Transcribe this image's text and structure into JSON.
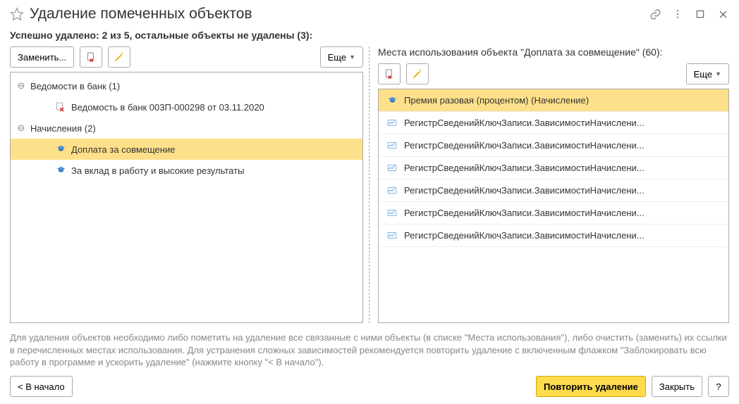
{
  "title": "Удаление помеченных объектов",
  "status": "Успешно удалено: 2 из 5, остальные объекты не удалены (3):",
  "left": {
    "replace_btn": "Заменить...",
    "more_btn": "Еще",
    "groups": [
      {
        "label": "Ведомости в банк (1)",
        "items": [
          {
            "label": "Ведомость в банк 003П-000298 от 03.11.2020",
            "type": "deleted-doc"
          }
        ]
      },
      {
        "label": "Начисления (2)",
        "items": [
          {
            "label": "Доплата за совмещение",
            "type": "payroll",
            "selected": true
          },
          {
            "label": "За вклад в работу и высокие результаты",
            "type": "payroll"
          }
        ]
      }
    ]
  },
  "right": {
    "header": "Места использования объекта \"Доплата за совмещение\" (60):",
    "more_btn": "Еще",
    "rows": [
      {
        "label": "Премия разовая (процентом) (Начисление)",
        "type": "payroll",
        "selected": true
      },
      {
        "label": "РегистрСведенийКлючЗаписи.ЗависимостиНачислени...",
        "type": "register"
      },
      {
        "label": "РегистрСведенийКлючЗаписи.ЗависимостиНачислени...",
        "type": "register"
      },
      {
        "label": "РегистрСведенийКлючЗаписи.ЗависимостиНачислени...",
        "type": "register"
      },
      {
        "label": "РегистрСведенийКлючЗаписи.ЗависимостиНачислени...",
        "type": "register"
      },
      {
        "label": "РегистрСведенийКлючЗаписи.ЗависимостиНачислени...",
        "type": "register"
      },
      {
        "label": "РегистрСведенийКлючЗаписи.ЗависимостиНачислени...",
        "type": "register"
      }
    ]
  },
  "help": "Для удаления объектов необходимо либо пометить на удаление все связанные с ними объекты (в списке \"Места использования\"), либо очистить (заменить) их ссылки в перечисленных местах использования. Для устранения сложных зависимостей рекомендуется повторить удаление с включенным флажком \"Заблокировать всю работу в программе и ускорить удаление\" (нажмите кнопку \"< В начало\").",
  "footer": {
    "back": "< В начало",
    "repeat": "Повторить удаление",
    "close": "Закрыть",
    "help": "?"
  }
}
